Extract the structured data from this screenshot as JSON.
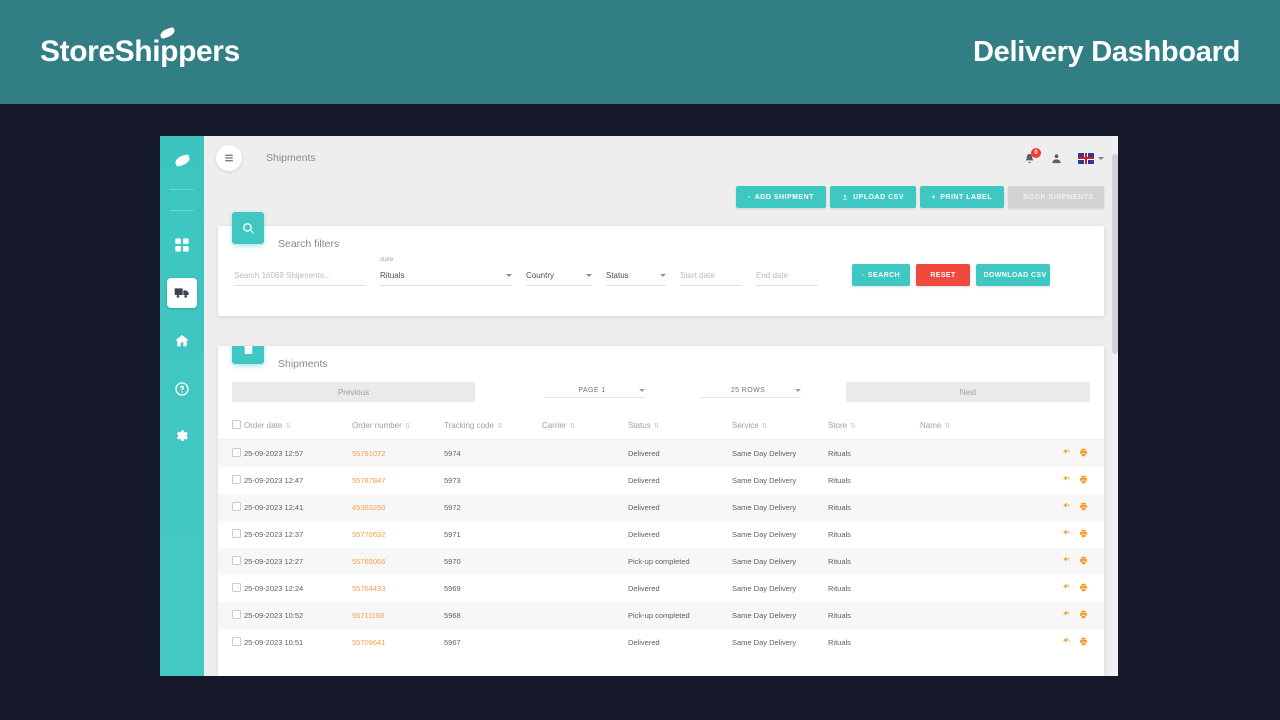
{
  "banner": {
    "brand": "StoreShippers",
    "title": "Delivery Dashboard"
  },
  "sidebar": {
    "items": [
      {
        "name": "logo-leaf",
        "label": ""
      },
      {
        "name": "dashboard",
        "label": ""
      },
      {
        "name": "shipments",
        "label": ""
      },
      {
        "name": "home",
        "label": ""
      },
      {
        "name": "help",
        "label": ""
      },
      {
        "name": "settings",
        "label": ""
      }
    ]
  },
  "topbar": {
    "title": "Shipments",
    "notification_count": "0",
    "language": "EN"
  },
  "actions": {
    "add_shipment": "ADD SHIPMENT",
    "upload_csv": "UPLOAD CSV",
    "print_label": "PRINT LABEL",
    "book_shipments": "BOOK SHIPMENTS"
  },
  "filters": {
    "title": "Search filters",
    "search_placeholder": "Search 16089 Shipments...",
    "search_value": "",
    "store_label": "store",
    "store_value": "Rituals",
    "country_value": "Country",
    "status_value": "Status",
    "start_date_placeholder": "Start date",
    "start_date_value": "",
    "end_date_placeholder": "End date",
    "end_date_value": "",
    "search_button": "SEARCH",
    "reset_button": "RESET",
    "download_button": "DOWNLOAD CSV"
  },
  "table": {
    "title": "Shipments",
    "previous_button": "Previous",
    "next_button": "Next",
    "page_select": "PAGE 1",
    "rows_select": "25 ROWS",
    "columns": [
      "Order date",
      "Order number",
      "Tracking code",
      "Carrier",
      "Status",
      "Service",
      "Store",
      "Name"
    ],
    "rows": [
      {
        "order_date": "25-09-2023 12:57",
        "order_number": "55791072",
        "tracking_code": "5974",
        "carrier": "",
        "status": "Delivered",
        "service": "Same Day Delivery",
        "store": "Rituals",
        "name": ""
      },
      {
        "order_date": "25-09-2023 12:47",
        "order_number": "55787847",
        "tracking_code": "5973",
        "carrier": "",
        "status": "Delivered",
        "service": "Same Day Delivery",
        "store": "Rituals",
        "name": ""
      },
      {
        "order_date": "25-09-2023 12:41",
        "order_number": "45363260",
        "tracking_code": "5972",
        "carrier": "",
        "status": "Delivered",
        "service": "Same Day Delivery",
        "store": "Rituals",
        "name": ""
      },
      {
        "order_date": "25-09-2023 12:37",
        "order_number": "55770692",
        "tracking_code": "5971",
        "carrier": "",
        "status": "Delivered",
        "service": "Same Day Delivery",
        "store": "Rituals",
        "name": ""
      },
      {
        "order_date": "25-09-2023 12:27",
        "order_number": "55765066",
        "tracking_code": "5970",
        "carrier": "",
        "status": "Pick-up completed",
        "service": "Same Day Delivery",
        "store": "Rituals",
        "name": ""
      },
      {
        "order_date": "25-09-2023 12:24",
        "order_number": "55764433",
        "tracking_code": "5969",
        "carrier": "",
        "status": "Delivered",
        "service": "Same Day Delivery",
        "store": "Rituals",
        "name": ""
      },
      {
        "order_date": "25-09-2023 10:52",
        "order_number": "55711168",
        "tracking_code": "5968",
        "carrier": "",
        "status": "Pick-up completed",
        "service": "Same Day Delivery",
        "store": "Rituals",
        "name": ""
      },
      {
        "order_date": "25-09-2023 10:51",
        "order_number": "55709641",
        "tracking_code": "5967",
        "carrier": "",
        "status": "Delivered",
        "service": "Same Day Delivery",
        "store": "Rituals",
        "name": ""
      }
    ]
  },
  "colors": {
    "banner_bg": "#317f85",
    "accent": "#3fc8c3",
    "danger": "#f04a3f",
    "link": "#f5a04a",
    "page_bg": "#141829"
  }
}
